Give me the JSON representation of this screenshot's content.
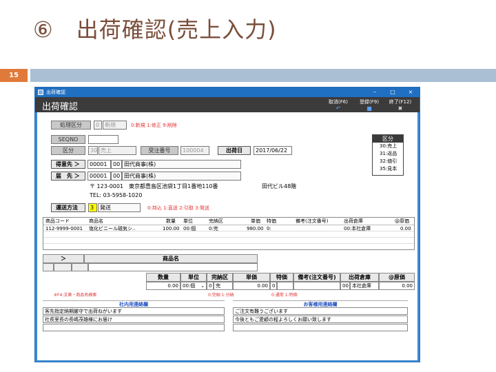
{
  "slide": {
    "title": "⑥　出荷確認(売上入力)",
    "page_number": "15"
  },
  "window": {
    "titlebar": "出荷確認",
    "header": "出荷確認",
    "buttons": {
      "minimize": "–",
      "maximize": "□",
      "close": "×"
    },
    "toolbar": [
      {
        "label": "取消(F6)",
        "icon": "undo-icon"
      },
      {
        "label": "登録(F9)",
        "icon": "save-icon"
      },
      {
        "label": "終了(F12)",
        "icon": "close-icon"
      }
    ]
  },
  "form": {
    "shori_kubun": {
      "label": "処理区分",
      "code": "0",
      "value": "新規",
      "note": "0:新規 1:修正 9:削除"
    },
    "seqno": {
      "label": "SEQNO",
      "value": ""
    },
    "kubun": {
      "label": "区分",
      "code": "30",
      "value": "売上"
    },
    "juchu": {
      "label": "受注番号",
      "value": "100004"
    },
    "shukkabi": {
      "label": "出荷日",
      "value": "2017/06/22"
    },
    "tokuisaki": {
      "label": "得意先 ＞",
      "code": "00001",
      "sub": "00",
      "name": "田代商事(株)"
    },
    "todokesaki": {
      "label": "届　先 ＞",
      "code": "00001",
      "sub": "00",
      "name": "田代商事(株)"
    },
    "address": "〒 123-0001　東京都豊島区池袋1丁目1番地110番",
    "building": "田代ビル48階",
    "tel": "TEL: 03-5958-1020",
    "unso": {
      "label": "運送方法",
      "code": "3",
      "value": "発送",
      "note": "0:持込 1:直送 2:引取 3:発送"
    }
  },
  "kubun_legend": {
    "title": "区分",
    "items": [
      "30:売上",
      "31:返品",
      "32:値引",
      "35:見本"
    ]
  },
  "detail_table": {
    "columns": [
      "商品コード",
      "商品名",
      "数量",
      "単位",
      "完納区",
      "単価",
      "特価",
      "備考(注文番号)",
      "出荷倉庫",
      "@原価"
    ],
    "rows": [
      [
        "112-9999-0001",
        "塩化ビニール磁気シ..",
        "100.00",
        "00:個",
        "0:完",
        "980.00",
        "0:",
        "",
        "00:本社倉庫",
        "0.00"
      ]
    ]
  },
  "entry": {
    "arrow": "＞",
    "product_header": "商品名",
    "columns": [
      "数量",
      "単位",
      "完納区",
      "単価",
      "特価",
      "備考(注文番号)",
      "出荷倉庫",
      "@原価"
    ],
    "values": {
      "qty": "0.00",
      "unit": "00:個",
      "kanno_code": "0",
      "kanno": "完",
      "price": "0.00",
      "tokka_code": "0",
      "tokka": "",
      "biko": "",
      "soko_code": "00",
      "soko": "本社倉庫",
      "genka": "0.00"
    },
    "note_search": "※F4:文章・商品名検索",
    "note_kanno": "0:完納 1:分納",
    "note_tokka": "0:通常 1:特価"
  },
  "internal_notes": {
    "title": "社内用連絡欄",
    "lines": [
      "客先指定納期厳守で出荷ねがいます",
      "社長室長の長嶋茂雄様にお届け",
      ""
    ]
  },
  "customer_notes": {
    "title": "お客様用連絡欄",
    "lines": [
      "ご注文有難うございます",
      "今後ともご愛顧の程よろしくお願い致します",
      ""
    ]
  },
  "colors": {
    "window_frame": "#3b8ad6",
    "header_bar": "#3b3b3b",
    "accent_orange": "#e07a3a",
    "highlight_yellow": "#ffff00"
  }
}
